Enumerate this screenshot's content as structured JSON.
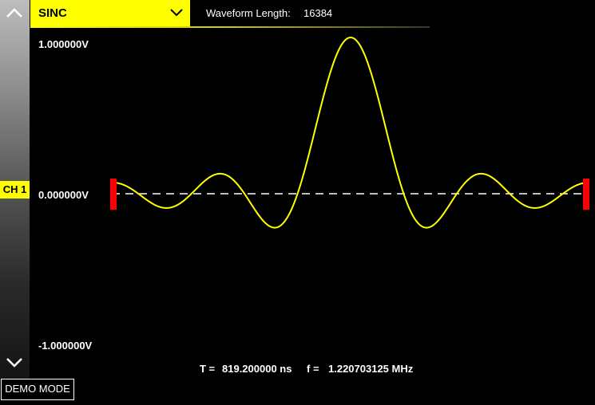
{
  "waveform": {
    "selected": "SINC",
    "length_label": "Waveform Length:",
    "length_value": "16384"
  },
  "channel": {
    "label": "CH 1",
    "color": "#ffff00"
  },
  "voltage_labels": {
    "max": "1.000000V",
    "zero": "0.000000V",
    "min": "-1.000000V"
  },
  "timing": {
    "t_label": "T =",
    "t_value": "819.200000 ns",
    "f_label": "f =",
    "f_value": "1.220703125 MHz"
  },
  "mode_badge": "DEMO MODE",
  "icons": {
    "scroll_up": "chevron-up-icon",
    "scroll_down": "chevron-down-icon",
    "dropdown": "chevron-down-icon"
  },
  "colors": {
    "accent": "#ffff00",
    "marker": "#ff0000",
    "trace": "#ffff00",
    "background": "#000000"
  },
  "chart_data": {
    "type": "line",
    "function": "sinc",
    "ylim": [
      -1,
      1
    ],
    "zero_line": true,
    "zero_line_style": "dashed",
    "xlim": [
      -4.5,
      4.5
    ]
  }
}
